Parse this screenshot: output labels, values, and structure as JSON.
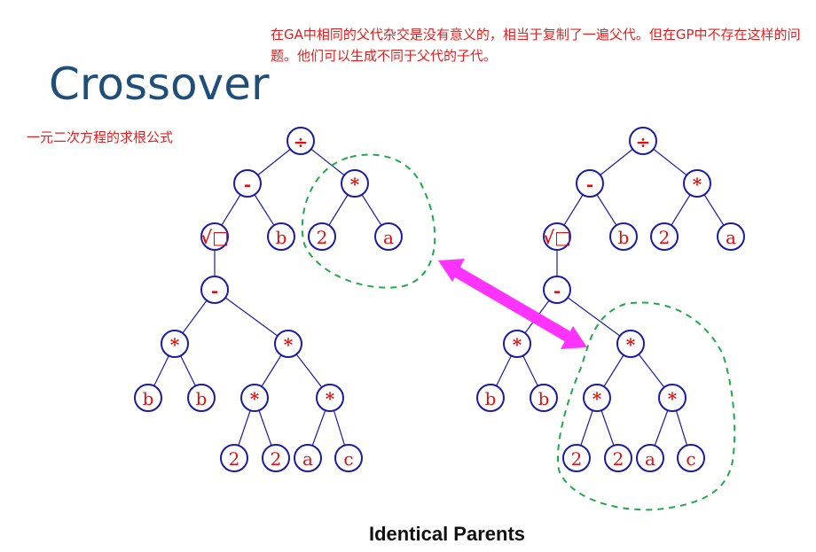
{
  "slide": {
    "title": "Crossover",
    "subtitle": "一元二次方程的求根公式",
    "note": "在GA中相同的父代杂交是没有意义的，相当于复制了一遍父代。但在GP中不存在这样的问题。他们可以生成不同于父代的子代。",
    "caption": "Identical Parents"
  },
  "colors": {
    "node_stroke": "#1a1aa8",
    "node_label": "#e01010",
    "selection_stroke": "#22a84a",
    "arrow": "#ff33ff",
    "title": "#1f4e79",
    "note_text": "#e02020"
  },
  "tree": {
    "labels": {
      "root": "÷",
      "minus_top": "-",
      "times_top": "*",
      "sqrt": "√□",
      "b_top": "b",
      "two_top": "2",
      "a_top": "a",
      "minus_mid": "-",
      "times_left": "*",
      "times_right": "*",
      "b_left1": "b",
      "b_left2": "b",
      "times_rl": "*",
      "times_rr": "*",
      "two_1": "2",
      "two_2": "2",
      "a_bottom": "a",
      "c_bottom": "c"
    }
  },
  "parents": [
    {
      "name": "parent-left",
      "highlighted_subtree": "times_top"
    },
    {
      "name": "parent-right",
      "highlighted_subtree": "times_right"
    }
  ]
}
